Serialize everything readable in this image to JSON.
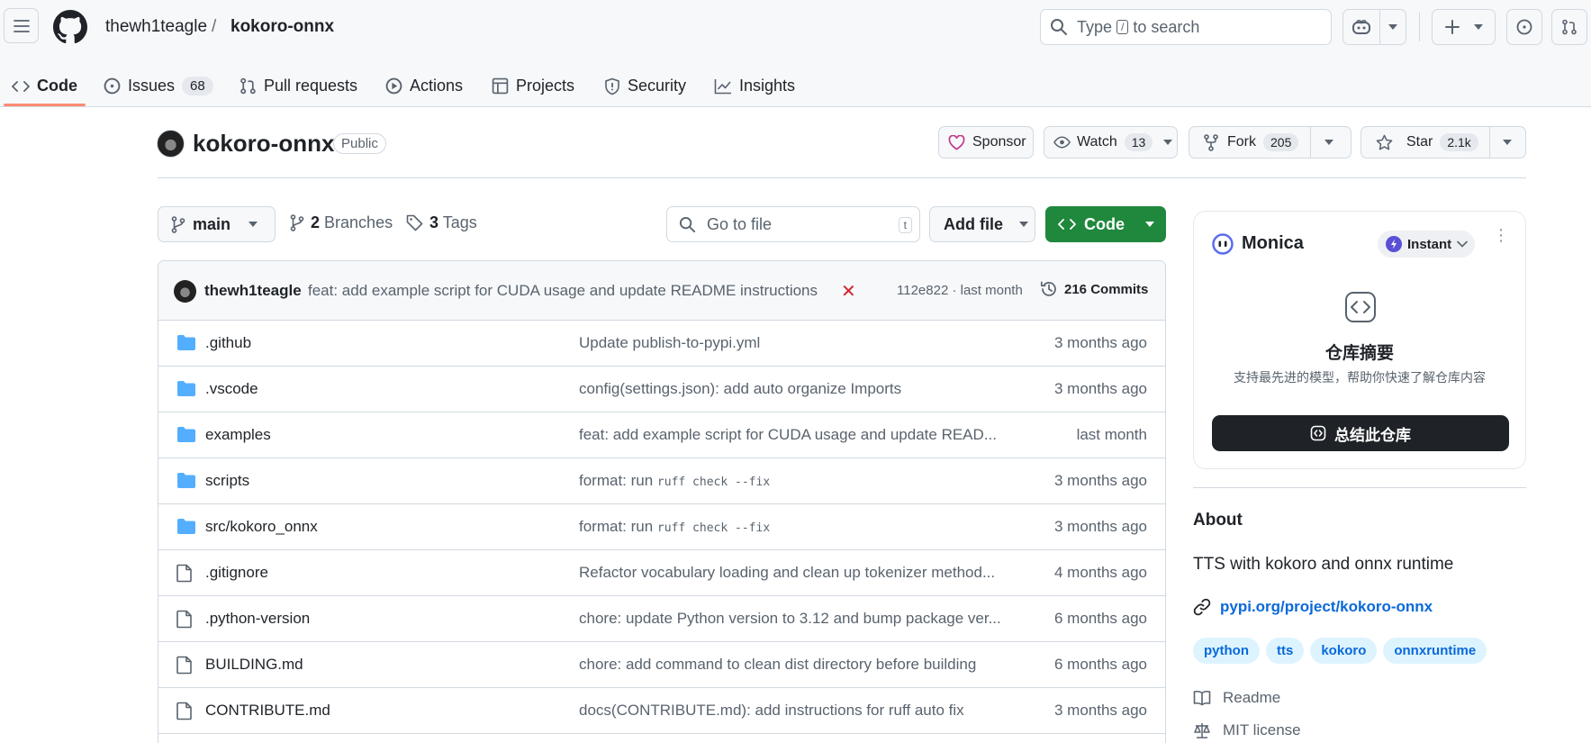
{
  "header": {
    "owner": "thewh1teagle",
    "separator": "/",
    "repo": "kokoro-onnx",
    "search": {
      "prefix": "Type",
      "key": "/",
      "suffix": "to search"
    }
  },
  "tabs": [
    {
      "label": "Code",
      "active": true
    },
    {
      "label": "Issues",
      "count": "68"
    },
    {
      "label": "Pull requests"
    },
    {
      "label": "Actions"
    },
    {
      "label": "Projects"
    },
    {
      "label": "Security"
    },
    {
      "label": "Insights"
    }
  ],
  "repo": {
    "name": "kokoro-onnx",
    "visibility": "Public",
    "sponsor_label": "Sponsor",
    "watch_label": "Watch",
    "watch_count": "13",
    "fork_label": "Fork",
    "fork_count": "205",
    "star_label": "Star",
    "star_count": "2.1k"
  },
  "toolbar": {
    "branch": "main",
    "branches_count": "2",
    "branches_label": "Branches",
    "tags_count": "3",
    "tags_label": "Tags",
    "goto_placeholder": "Go to file",
    "goto_key": "t",
    "add_file_label": "Add file",
    "code_label": "Code"
  },
  "latest_commit": {
    "author": "thewh1teagle",
    "message": "feat: add example script for CUDA usage and update README instructions",
    "status": "✕",
    "sha_time": "112e822 · last month",
    "commits_label": "216 Commits"
  },
  "files": [
    {
      "type": "dir",
      "name": ".github",
      "message": "Update publish-to-pypi.yml",
      "time": "3 months ago"
    },
    {
      "type": "dir",
      "name": ".vscode",
      "message": "config(settings.json): add auto organize Imports",
      "time": "3 months ago"
    },
    {
      "type": "dir",
      "name": "examples",
      "message": "feat: add example script for CUDA usage and update READ...",
      "time": "last month"
    },
    {
      "type": "dir",
      "name": "scripts",
      "message": "format: run ",
      "code": "ruff check --fix",
      "time": "3 months ago"
    },
    {
      "type": "dir",
      "name": "src/kokoro_onnx",
      "message": "format: run ",
      "code": "ruff check --fix",
      "time": "3 months ago"
    },
    {
      "type": "file",
      "name": ".gitignore",
      "message": "Refactor vocabulary loading and clean up tokenizer method...",
      "time": "4 months ago"
    },
    {
      "type": "file",
      "name": ".python-version",
      "message": "chore: update Python version to 3.12 and bump package ver...",
      "time": "6 months ago"
    },
    {
      "type": "file",
      "name": "BUILDING.md",
      "message": "chore: add command to clean dist directory before building",
      "time": "6 months ago"
    },
    {
      "type": "file",
      "name": "CONTRIBUTE.md",
      "message": "docs(CONTRIBUTE.md): add instructions for ruff auto fix",
      "time": "3 months ago"
    }
  ],
  "monica": {
    "name": "Monica",
    "mode": "Instant",
    "title": "仓库摘要",
    "subtitle": "支持最先进的模型，帮助你快速了解仓库内容",
    "button": "总结此仓库"
  },
  "about": {
    "title": "About",
    "description": "TTS with kokoro and onnx runtime",
    "link": "pypi.org/project/kokoro-onnx",
    "topics": [
      "python",
      "tts",
      "kokoro",
      "onnxruntime"
    ],
    "readme": "Readme",
    "license": "MIT license"
  },
  "colors": {
    "accent_green": "#1f883d",
    "link_blue": "#0969da",
    "folder_blue": "#54aeff",
    "tab_underline": "#fd8c73"
  }
}
